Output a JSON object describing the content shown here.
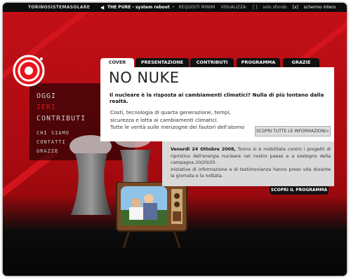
{
  "topbar": {
    "brand": "TORINOSISTEMASOLARE",
    "music": "THE PURE - system reboot",
    "requisiti": "REQUISITI MINIMI",
    "visualizza": "VISUALIZZA:",
    "solo_sfondo": "solo sfondo",
    "schermo_intero": "schermo intero"
  },
  "menu": {
    "oggi": "OGGI",
    "ieri": "IERI",
    "contributi": "CONTRIBUTI",
    "chi_siamo": "CHI SIAMO",
    "contatti": "CONTATTI",
    "grazie": "GRAZIE"
  },
  "tabs": {
    "cover": "COVER",
    "presentazione": "PRESENTAZIONE",
    "contributi": "CONTRIBUTI",
    "programma": "PROGRAMMA",
    "grazie": "GRAZIE"
  },
  "panel": {
    "headline": "NO NUKE",
    "subtitle": "Il nucleare è la risposta ai cambiamenti climatici? Nulla di più lontano dalla realtà.",
    "desc1": "Costi, tecnologia di quarta generazione, tempi,",
    "desc2": "sicurezza e lotta ai cambiamenti climatici.",
    "desc3": "Tutte le verità sulle menzogne dei fautori dell'atomo",
    "scopri": "SCOPRI TUTTE LE INFORMAZIONI>"
  },
  "news": {
    "date": "Venerdì 24 Ottobre 2008,",
    "text1": "Torino si è mobilitata contro i progetti di ripristino dell'energia nucleare nel nostro paese e a sostegno della campagna 20/20/20.",
    "text2": "Iniziative di informazione e di testimonianza hanno preso vita durante la giornata e la nottata.",
    "programma_button": "SCOPRI IL PROGRAMMA"
  },
  "colors": {
    "accent_red": "#b80b12",
    "dark": "#0c0c0c",
    "panel_white": "#ffffff",
    "panel_gray": "#d9d9d9"
  },
  "icons": {
    "speaker": "speaker-icon",
    "logo": "target-logo",
    "tv": "retro-tv-image",
    "towers": "cooling-towers-image"
  }
}
